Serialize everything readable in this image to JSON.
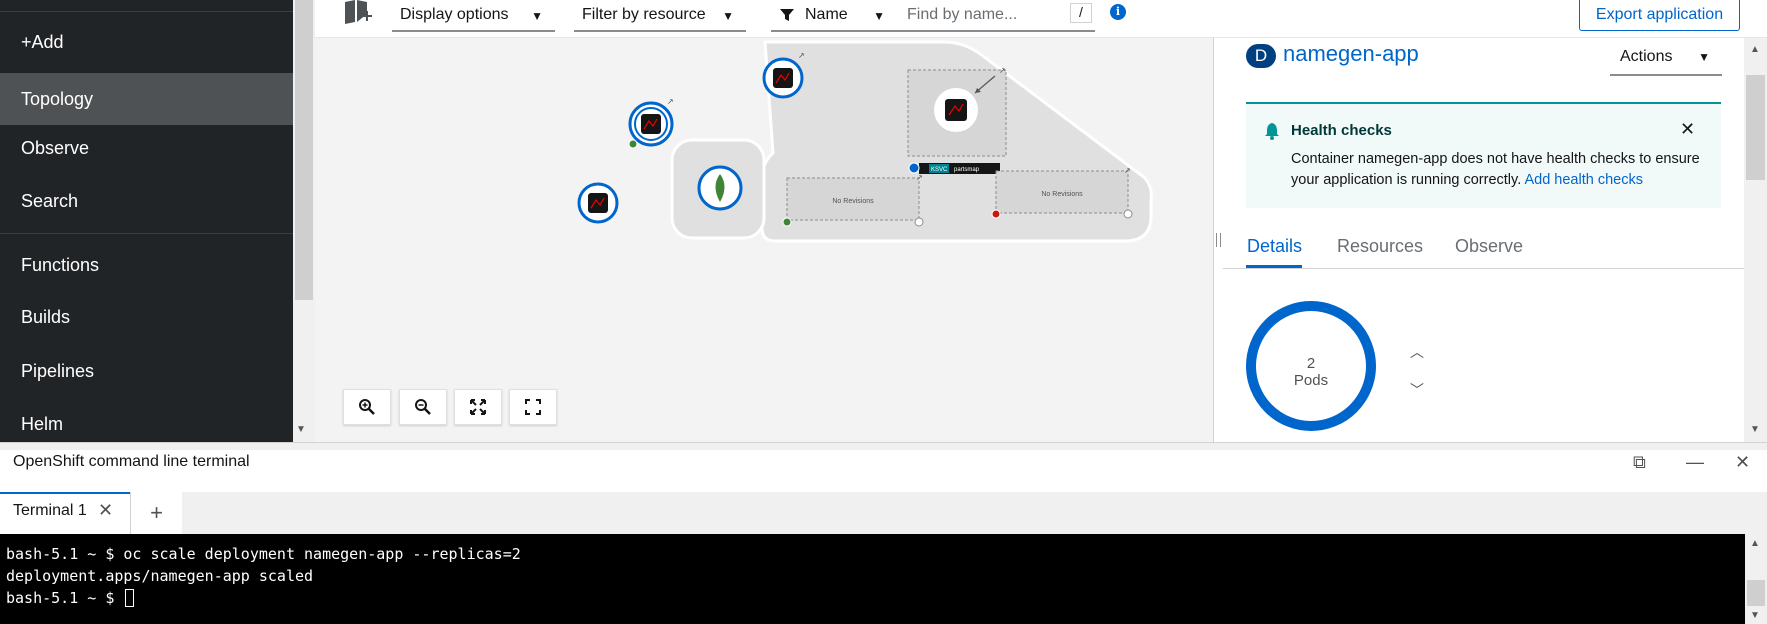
{
  "sidebar": {
    "items": [
      {
        "label": "+Add"
      },
      {
        "label": "Topology",
        "active": true
      },
      {
        "label": "Observe"
      },
      {
        "label": "Search"
      },
      {
        "label": "Functions"
      },
      {
        "label": "Builds"
      },
      {
        "label": "Pipelines"
      },
      {
        "label": "Helm"
      }
    ]
  },
  "toolbar": {
    "display_options": "Display options",
    "filter_by_resource": "Filter by resource",
    "filter_type": "Name",
    "search_placeholder": "Find by name...",
    "search_shortcut": "/",
    "info_icon": "info-circle-icon",
    "export_label": "Export application"
  },
  "topology": {
    "knative_label": "KSVC",
    "knative_name": "partsmap",
    "no_revisions_label": "No Revisions",
    "zoom_controls": [
      "zoom-in-icon",
      "zoom-out-icon",
      "fit-to-screen-icon",
      "expand-icon"
    ]
  },
  "panel": {
    "resource_badge": "D",
    "title": "namegen-app",
    "actions_label": "Actions",
    "alert": {
      "title": "Health checks",
      "message": "Container namegen-app does not have health checks to ensure your application is running correctly.",
      "link": "Add health checks"
    },
    "tabs": [
      {
        "label": "Details",
        "active": true
      },
      {
        "label": "Resources"
      },
      {
        "label": "Observe"
      }
    ],
    "pods": {
      "count": "2",
      "label": "Pods"
    }
  },
  "terminal": {
    "title": "OpenShift command line terminal",
    "tab_label": "Terminal 1",
    "lines": [
      "bash-5.1 ~ $ oc scale deployment namegen-app --replicas=2",
      "deployment.apps/namegen-app scaled",
      "bash-5.1 ~ $ "
    ]
  },
  "colors": {
    "sidebar_bg": "#212427",
    "accent": "#0066cc",
    "alert_border": "#009596",
    "terminal_bg": "#000000"
  }
}
